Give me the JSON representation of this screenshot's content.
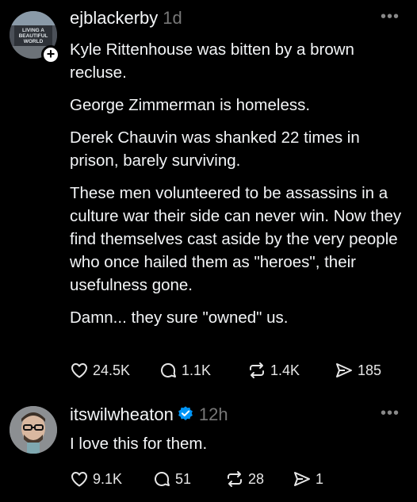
{
  "posts": [
    {
      "username": "ejblackerby",
      "time": "1d",
      "more_icon": "more-horizontal-icon",
      "avatar_text": "LIVING A BEAUTIFUL WORLD",
      "paragraphs": [
        "Kyle Rittenhouse was bitten by a brown recluse.",
        "George Zimmerman is homeless.",
        "Derek Chauvin was shanked 22 times in prison, barely surviving.",
        "These men volunteered to be assassins in a culture war their side can never win. Now they find themselves cast aside by the very people who once hailed them as \"heroes\", their usefulness gone.",
        "Damn... they sure \"owned\" us."
      ],
      "likes": "24.5K",
      "replies": "1.1K",
      "reposts": "1.4K",
      "shares": "185"
    },
    {
      "username": "itswilwheaton",
      "verified": true,
      "time": "12h",
      "more_icon": "more-horizontal-icon",
      "paragraphs": [
        "I love this for them."
      ],
      "likes": "9.1K",
      "replies": "51",
      "reposts": "28",
      "shares": "1"
    }
  ],
  "colors": {
    "background": "#000000",
    "text": "#f3f5f7",
    "muted": "#777777",
    "verified": "#0095f6"
  }
}
